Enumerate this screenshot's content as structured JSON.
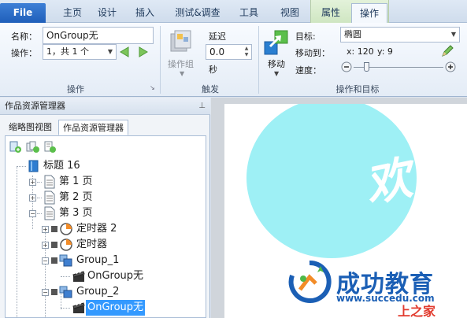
{
  "tabs": {
    "file": "File",
    "items": [
      "主页",
      "设计",
      "插入",
      "测试&调查",
      "工具",
      "视图",
      "属性",
      "操作"
    ],
    "active": "操作"
  },
  "ribbon": {
    "operation_group": {
      "name_label": "名称：",
      "name_value": "OnGroup无",
      "op_label": "操作：",
      "op_value": "1，共 1 个",
      "group_label": "操作"
    },
    "trigger_group": {
      "opgroup_label": "操作组",
      "delay_label": "延迟",
      "delay_value": "0.0",
      "sec_label": "秒",
      "group_label": "触发"
    },
    "target_group": {
      "move_label": "移动",
      "target_label": "目标:",
      "target_value": "椭圆",
      "move_to_label": "移动到：",
      "x_text": "x: 120",
      "y_text": "y: 9",
      "speed_label": "速度：",
      "speed_level": 0.12,
      "group_label": "操作和目标"
    }
  },
  "panel": {
    "title": "作品资源管理器",
    "pin": "ᵖ",
    "tab_thumb": "缩略图视图",
    "tab_explorer": "作品资源管理器"
  },
  "tree": {
    "root": "标题 16",
    "p1": "第 1 页",
    "p2": "第 2 页",
    "p3": "第 3 页",
    "timer2": "定时器 2",
    "timer": "定时器",
    "group1": "Group_1",
    "ongroup1": "OnGroup无",
    "group2": "Group_2",
    "ongroup2": "OnGroup无"
  },
  "canvas": {
    "big_glyph": "欢",
    "watermark_title": "成功教育",
    "watermark_url": "www.succedu.com",
    "watermark_corner": "上之家"
  },
  "colors": {
    "file_tab": "#2a6cc8",
    "context_tab": "#d9ecd0",
    "ellipse": "#9ef0f5",
    "selection": "#3399ff"
  }
}
